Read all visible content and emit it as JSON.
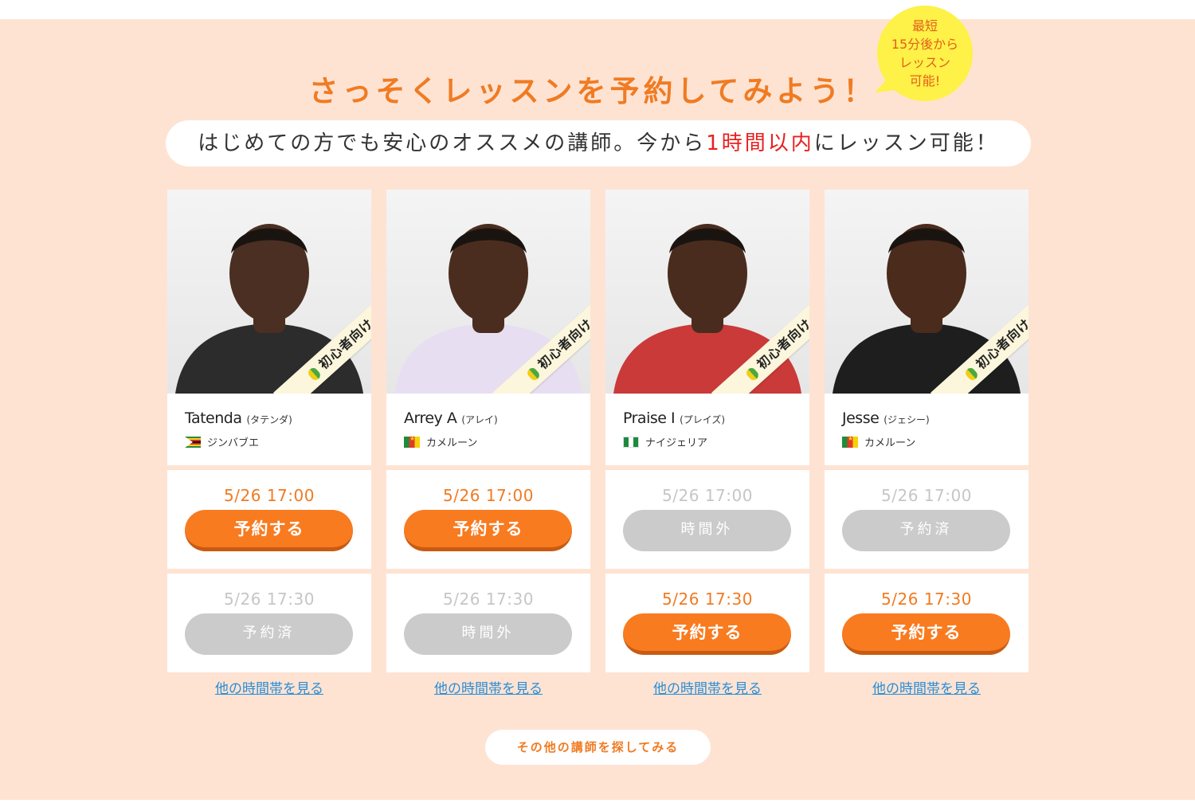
{
  "header": {
    "headline": "さっそくレッスンを予約してみよう！",
    "bubble": "最短\n15分後から\nレッスン\n可能!",
    "subhead_before": "はじめての方でも安心のオススメの講師。今から",
    "subhead_highlight": "1時間以内",
    "subhead_after": "にレッスン可能！"
  },
  "badge_label": "初心者向け",
  "teachers": [
    {
      "name": "Tatenda",
      "kana": "(タテンダ)",
      "country": "ジンバブエ",
      "flag": "zimbabwe",
      "skin": "#4a2f22",
      "shirt": "#2c2c2c",
      "slots": [
        {
          "time": "5/26 17:00",
          "label": "予約する",
          "status": "available"
        },
        {
          "time": "5/26 17:30",
          "label": "予約済",
          "status": "booked"
        }
      ],
      "more_link": "他の時間帯を見る"
    },
    {
      "name": "Arrey A",
      "kana": "(アレイ)",
      "country": "カメルーン",
      "flag": "cameroon",
      "skin": "#4b2d1f",
      "shirt": "#e8def2",
      "slots": [
        {
          "time": "5/26 17:00",
          "label": "予約する",
          "status": "available"
        },
        {
          "time": "5/26 17:30",
          "label": "時間外",
          "status": "unavailable"
        }
      ],
      "more_link": "他の時間帯を見る"
    },
    {
      "name": "Praise I",
      "kana": "(プレイズ)",
      "country": "ナイジェリア",
      "flag": "nigeria",
      "skin": "#4a2c1e",
      "shirt": "#c93a38",
      "slots": [
        {
          "time": "5/26 17:00",
          "label": "時間外",
          "status": "unavailable"
        },
        {
          "time": "5/26 17:30",
          "label": "予約する",
          "status": "available"
        }
      ],
      "more_link": "他の時間帯を見る"
    },
    {
      "name": "Jesse",
      "kana": "(ジェシー)",
      "country": "カメルーン",
      "flag": "cameroon",
      "skin": "#4a2b1c",
      "shirt": "#1e1e1e",
      "slots": [
        {
          "time": "5/26 17:00",
          "label": "予約済",
          "status": "booked"
        },
        {
          "time": "5/26 17:30",
          "label": "予約する",
          "status": "available"
        }
      ],
      "more_link": "他の時間帯を見る"
    }
  ],
  "cta": "その他の講師を探してみる",
  "colors": {
    "background": "#fee3d3",
    "accent": "#f07b22",
    "button": "#f87b20",
    "disabled": "#cbcbcb",
    "highlight": "#e8201f",
    "link": "#2a8dd4"
  }
}
